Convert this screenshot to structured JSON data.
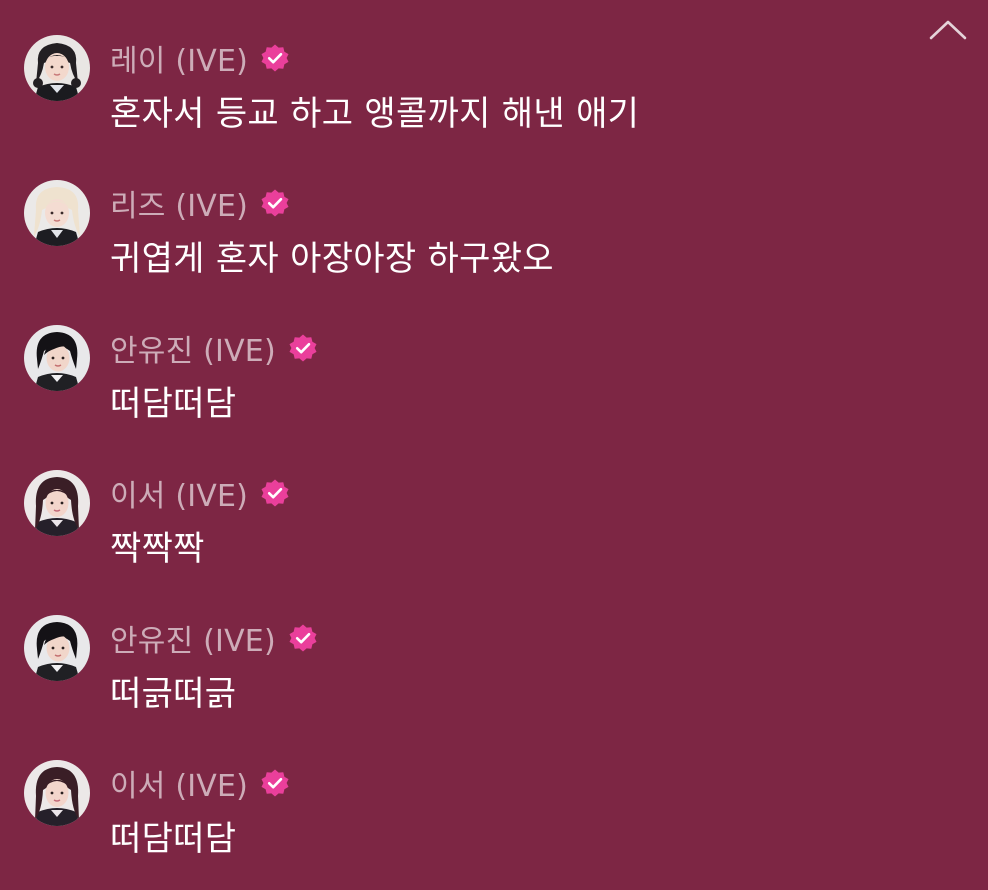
{
  "theme": {
    "background": "#7d2644",
    "name_color": "#d4a7b6",
    "text_color": "#ffffff",
    "badge_color": "#ea3f9b"
  },
  "header": {
    "collapse_icon": "chevron-up-icon"
  },
  "messages": [
    {
      "author": "레이 (IVE)",
      "verified_icon": "verified-badge-icon",
      "text": "혼자서 등교 하고 앵콜까지 해낸 애기",
      "avatar": "rei-avatar"
    },
    {
      "author": "리즈 (IVE)",
      "verified_icon": "verified-badge-icon",
      "text": "귀엽게 혼자 아장아장 하구왔오",
      "avatar": "liz-avatar"
    },
    {
      "author": "안유진 (IVE)",
      "verified_icon": "verified-badge-icon",
      "text": "떠담떠담",
      "avatar": "yujin-avatar"
    },
    {
      "author": "이서 (IVE)",
      "verified_icon": "verified-badge-icon",
      "text": "짝짝짝",
      "avatar": "leeseo-avatar"
    },
    {
      "author": "안유진 (IVE)",
      "verified_icon": "verified-badge-icon",
      "text": "떠긁떠긁",
      "avatar": "yujin-avatar"
    },
    {
      "author": "이서 (IVE)",
      "verified_icon": "verified-badge-icon",
      "text": "떠담떠담",
      "avatar": "leeseo-avatar"
    }
  ]
}
